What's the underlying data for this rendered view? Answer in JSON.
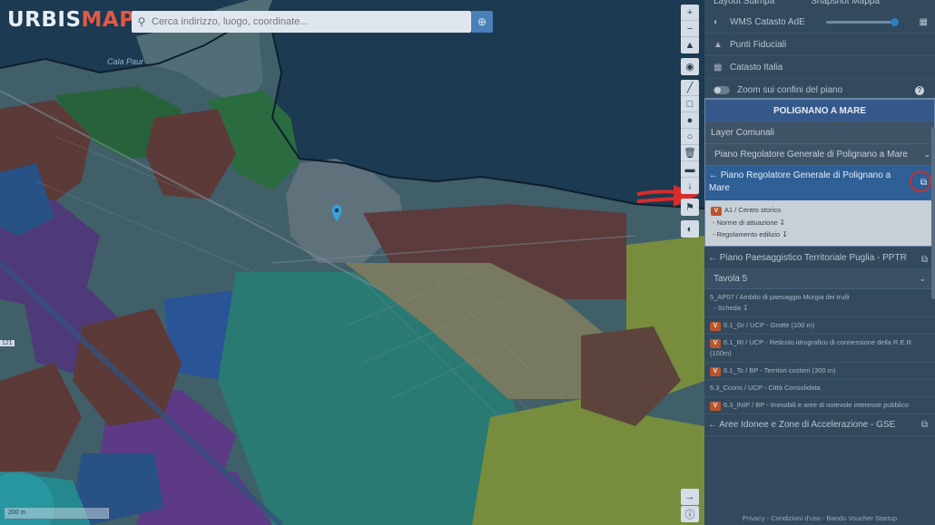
{
  "app": {
    "logo_part1": "URBIS",
    "logo_part2": "MAP"
  },
  "search": {
    "placeholder": "Cerca indirizzo, luogo, coordinate..."
  },
  "map": {
    "place_label": "Cala Paur",
    "road_badge": "121",
    "scale_label": "200 m"
  },
  "panel": {
    "top_tabs": [
      "Layout Stampa",
      "Snapshot Mappa"
    ],
    "wms_label": "WMS Catasto AdE",
    "punti_label": "Punti Fiduciali",
    "catasto_label": "Catasto Italia",
    "zoom_label": "Zoom sui confini del piano",
    "municipality": "POLIGNANO A MARE",
    "layer_title": "Layer Comunali",
    "select_value": "Piano Regolatore Generale di Polignano a Mare",
    "active_plan": {
      "title": "Piano Regolatore Generale di Polignano a Mare",
      "zone": "A1 / Centro storico",
      "links": [
        "- Norme di attuazione",
        "- Regolamento edilizio"
      ],
      "badge": "V"
    },
    "pptr": {
      "title": "Piano Paesaggistico Territoriale Puglia - PPTR",
      "tavola": "Tavola 5",
      "items": [
        {
          "badge": "",
          "text": "5_AP07 / Ambito di paesaggio Murgia dei trulli",
          "sub": "- Scheda"
        },
        {
          "badge": "V",
          "text": "6.1_Gr / UCP - Grotte (100 m)",
          "sub": ""
        },
        {
          "badge": "V",
          "text": "6.1_RI / UCP - Reticolo idrografico di connessione della R.E.R. (100m)",
          "sub": ""
        },
        {
          "badge": "V",
          "text": "6.1_Tc / BP - Territori costieri (300 m)",
          "sub": ""
        },
        {
          "badge": "",
          "text": "6.3_Ccons / UCP - Città Consolidata",
          "sub": ""
        },
        {
          "badge": "V",
          "text": "6.3_INIP / BP - Immobili e aree di notevole interesse pubblico",
          "sub": ""
        }
      ]
    },
    "aree": "Aree Idonee e Zone di Accelerazione - GSE",
    "footer": "Privacy - Condizioni d'uso - Bando Voucher Startup"
  },
  "colors": {
    "accent": "#2e5f95",
    "annotation": "#d92b2b",
    "sea": "#1f3f58"
  }
}
